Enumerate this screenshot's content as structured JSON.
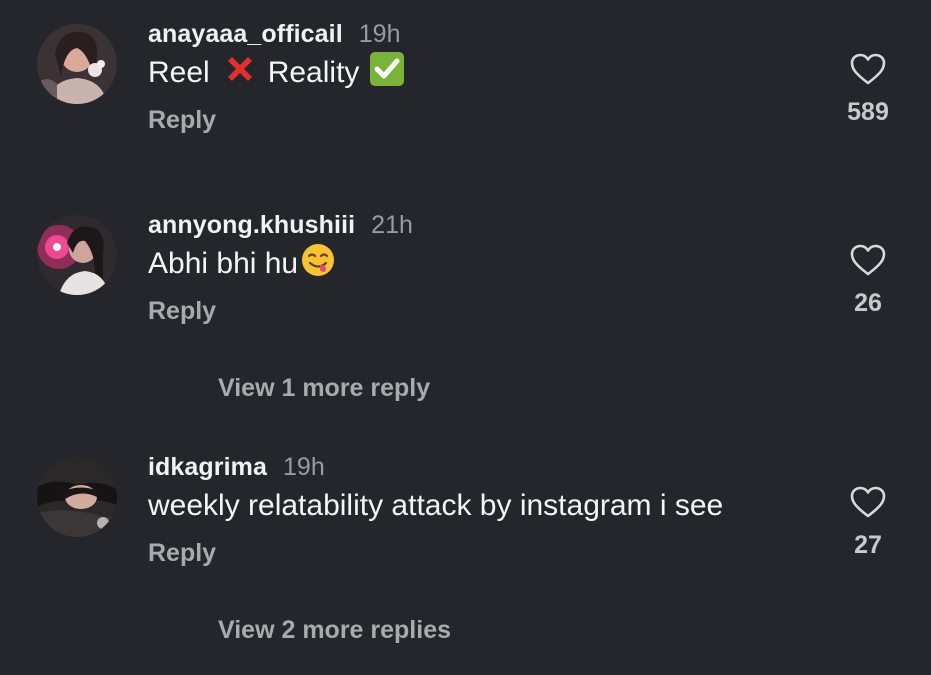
{
  "comments": [
    {
      "username": "anayaaa_officail",
      "time": "19h",
      "text_parts": [
        "Reel",
        "Reality"
      ],
      "reply_label": "Reply",
      "likes": "589",
      "icons": [
        "cross-mark-emoji",
        "check-mark-emoji"
      ]
    },
    {
      "username": "annyong.khushiii",
      "time": "21h",
      "text": "Abhi bhi hu",
      "reply_label": "Reply",
      "likes": "26",
      "view_more": "View 1 more reply",
      "icons": [
        "yum-face-emoji"
      ]
    },
    {
      "username": "idkagrima",
      "time": "19h",
      "text": "weekly relatability attack by instagram i see",
      "reply_label": "Reply",
      "likes": "27",
      "view_more": "View 2 more replies"
    }
  ],
  "colors": {
    "background": "#25262b",
    "primary_text": "#f2f2f2",
    "secondary_text": "#9a9ba0",
    "heart_outline": "#d9d9dc"
  }
}
